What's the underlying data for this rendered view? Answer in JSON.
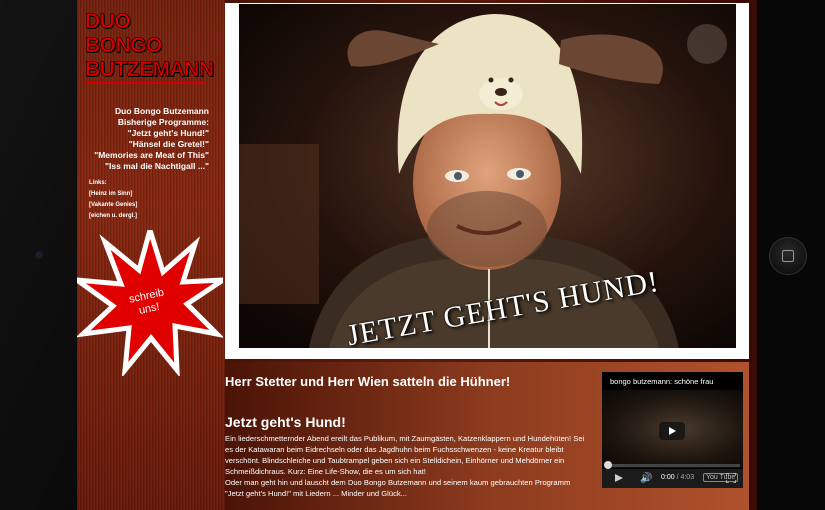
{
  "site": {
    "logo_lines": [
      "DUO",
      "BONGO",
      "BUTZEMANN"
    ]
  },
  "sidebar": {
    "programs": [
      "Duo Bongo Butzemann",
      "Bisherige Programme:",
      "\"Jetzt geht's Hund!\"",
      "\"Hänsel die Gretel!\"",
      "\"Memories are Meat of This\"",
      "\"Iss mal die Nachtigall ...\""
    ],
    "links_title": "Links:",
    "links": [
      "[Heinz im Sinn]",
      "[Vakante Genies]",
      "[eichen u. dergl.]"
    ],
    "starburst_text": "schreib uns!"
  },
  "hero": {
    "title": "JETZT GEHT'S HUND!"
  },
  "content": {
    "headline": "Herr Stetter und Herr Wien satteln die Hühner!",
    "subhead": "Jetzt geht's Hund!",
    "body_p1": "Ein liederschmetternder Abend ereilt das Publikum, mit Zaumgästen, Katzenklappern und Hundehüten! Sei es der Katawaran beim Eidrechseln oder das Jagdhuhn beim Fuchsschwenzen - keine Kreatur bleibt verschönt. Blindschleiche und Taubtrampel geben sich ein Stelldichein, Einhörner und Mehdörner ein Schmeißdichraus. Kurz: Eine Life-Show, die es um sich hat!",
    "body_p2": "Oder man geht hin und lauscht dem Duo Bongo Butzemann und seinem kaum gebrauchten Programm \"Jetzt geht's Hund!\" mit Liedern ... Minder und Glück..."
  },
  "video": {
    "title": "bongo butzemann: schöne frau",
    "time_current": "0:00",
    "time_duration": "/ 4:03",
    "progress": 0.0,
    "yt_label": "You Tube"
  },
  "colors": {
    "logo_red": "#d40000",
    "page_brown": "#5c1a0a",
    "sidebar_red": "#8d2a12"
  }
}
